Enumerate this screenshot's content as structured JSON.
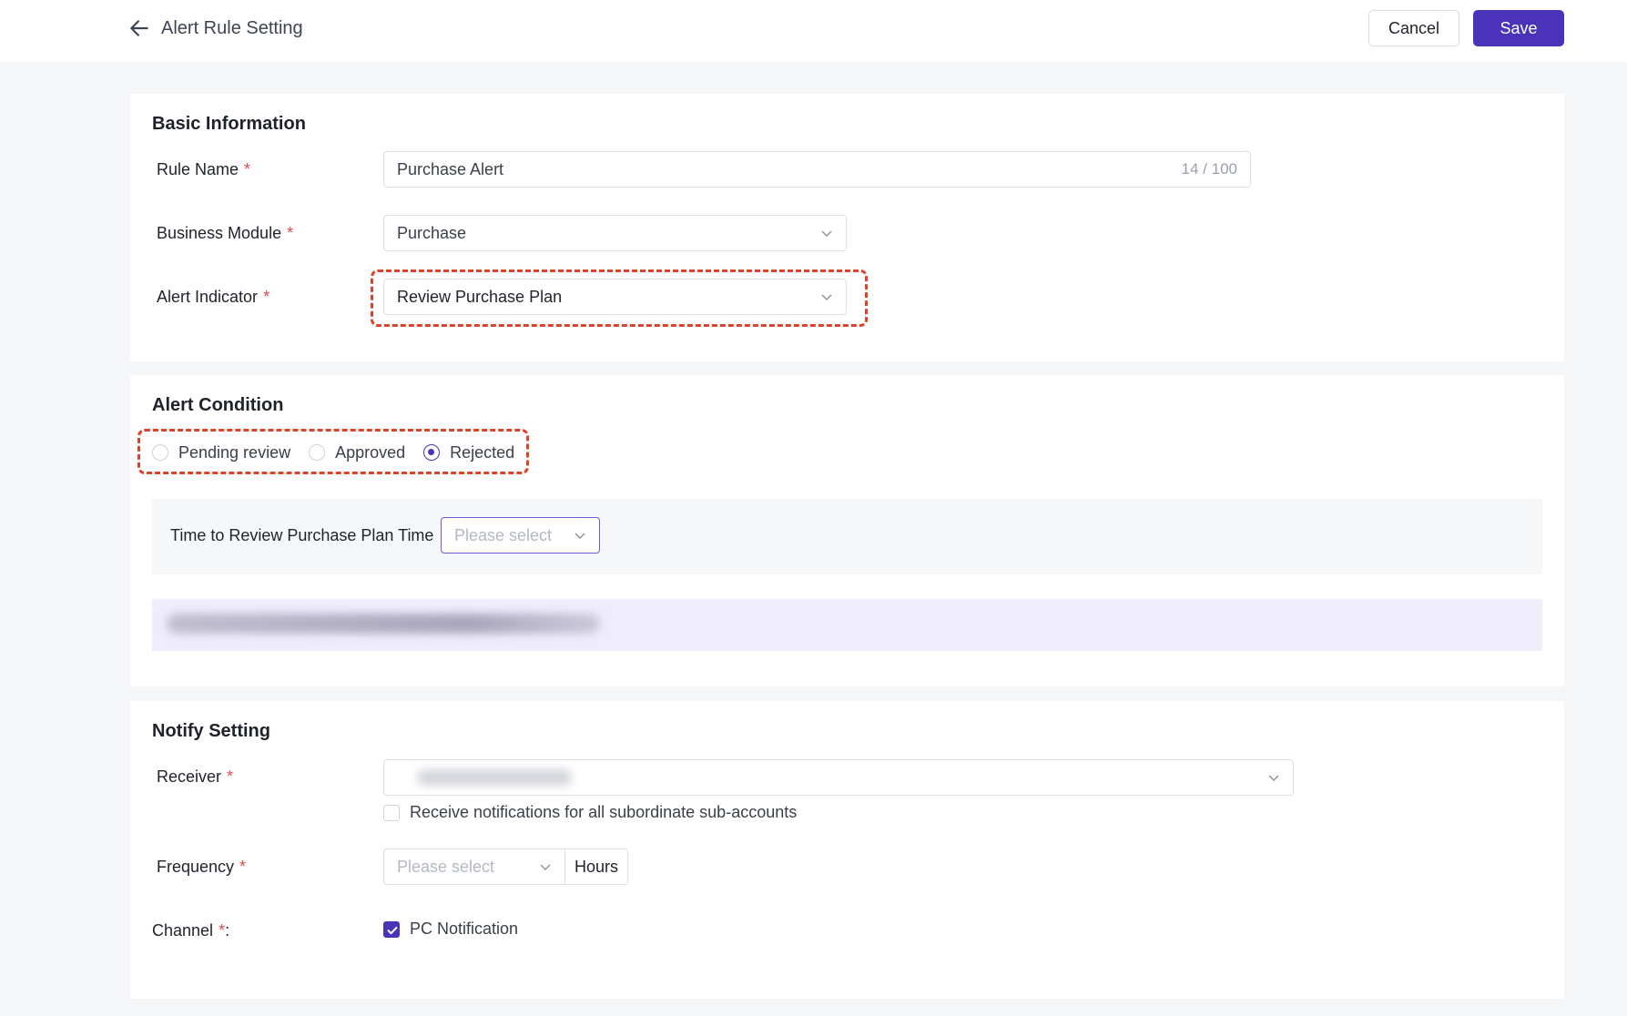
{
  "header": {
    "title": "Alert Rule Setting",
    "cancel_label": "Cancel",
    "save_label": "Save"
  },
  "basic": {
    "title": "Basic Information",
    "rule_name_label": "Rule Name",
    "rule_name_value": "Purchase Alert",
    "rule_name_counter": "14 / 100",
    "business_module_label": "Business Module",
    "business_module_value": "Purchase",
    "alert_indicator_label": "Alert Indicator",
    "alert_indicator_value": "Review Purchase Plan",
    "required_mark": "*"
  },
  "condition": {
    "title": "Alert Condition",
    "options": [
      {
        "label": "Pending review",
        "checked": false
      },
      {
        "label": "Approved",
        "checked": false
      },
      {
        "label": "Rejected",
        "checked": true
      }
    ],
    "time_label": "Time to Review Purchase Plan Time",
    "time_placeholder": "Please select"
  },
  "notify": {
    "title": "Notify Setting",
    "receiver_label": "Receiver",
    "subaccounts_label": "Receive notifications for all subordinate sub-accounts",
    "subaccounts_checked": false,
    "frequency_label": "Frequency",
    "frequency_placeholder": "Please select",
    "frequency_unit": "Hours",
    "channel_label": "Channel",
    "channel_suffix": ":",
    "channel_option": "PC Notification",
    "channel_checked": true
  },
  "icons": {
    "back": "arrow-left-icon",
    "dropdown": "chevron-down-icon",
    "check": "check-icon"
  },
  "colors": {
    "primary": "#4b33b9",
    "required": "#e5484d",
    "highlight": "#d9442b"
  }
}
